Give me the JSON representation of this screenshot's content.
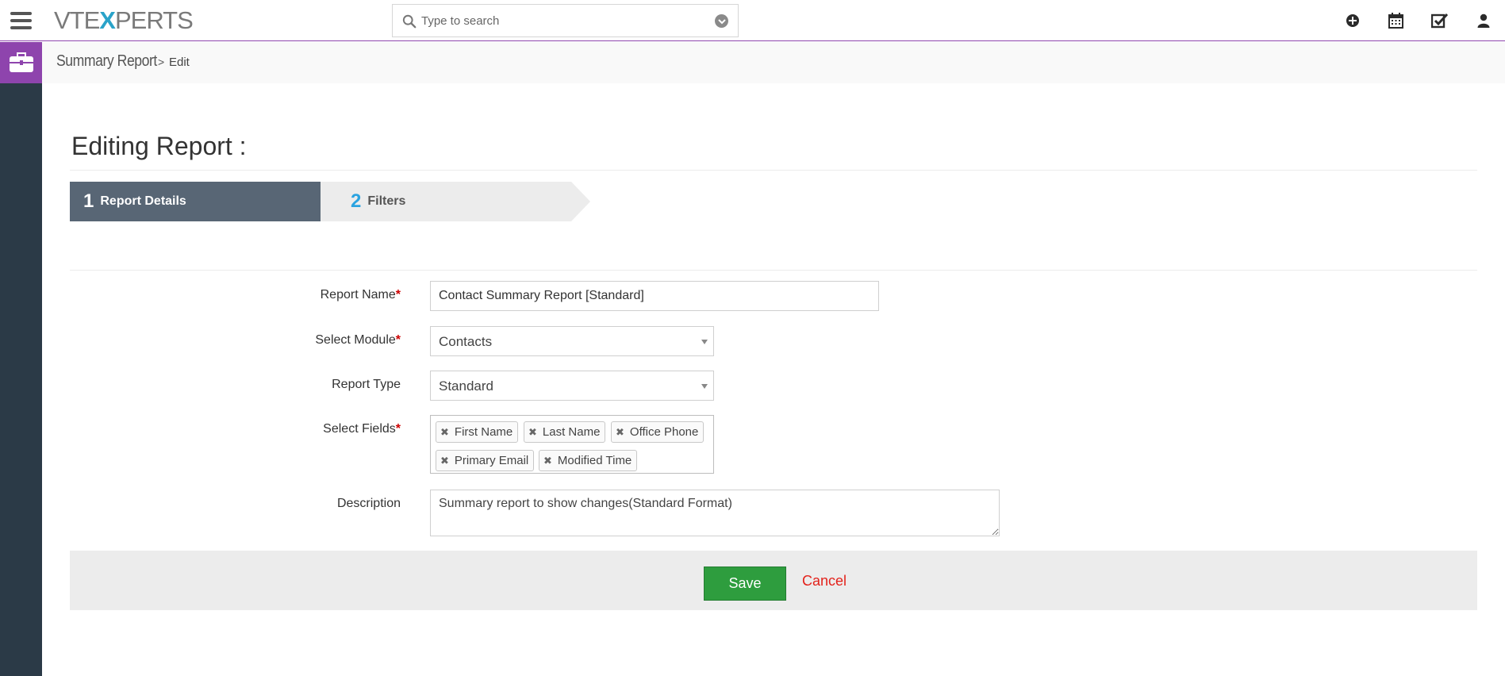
{
  "header": {
    "logo_text_a": "VTE",
    "logo_text_x": "X",
    "logo_text_b": "PERTS",
    "search": {
      "placeholder": "Type to search"
    },
    "icons": [
      "add-icon",
      "calendar-icon",
      "tasks-icon",
      "user-icon"
    ]
  },
  "breadcrumb": {
    "module": "Summary Report",
    "separator": ">",
    "current": "Edit"
  },
  "page": {
    "title": "Editing Report :"
  },
  "steps": [
    {
      "number": "1",
      "label": "Report Details",
      "active": true
    },
    {
      "number": "2",
      "label": "Filters",
      "active": false
    }
  ],
  "form": {
    "report_name": {
      "label": "Report Name",
      "required": "*",
      "value": "Contact Summary Report [Standard]"
    },
    "module": {
      "label": "Select Module",
      "required": "*",
      "value": "Contacts"
    },
    "report_type": {
      "label": "Report Type",
      "value": "Standard"
    },
    "fields": {
      "label": "Select Fields",
      "required": "*",
      "remove_glyph": "✖",
      "selected": [
        "First Name",
        "Last Name",
        "Office Phone",
        "Primary Email",
        "Modified Time"
      ]
    },
    "description": {
      "label": "Description",
      "value": "Summary report to show changes(Standard Format)"
    }
  },
  "actions": {
    "save_label": "Save",
    "cancel_label": "Cancel"
  },
  "colors": {
    "accent": "#8e44ad",
    "sidebar": "#2b3a47",
    "step_active": "#586675",
    "step_number": "#2aa3e0",
    "save": "#2e9d3e",
    "cancel": "#e3221b",
    "required": "#cc0000"
  }
}
